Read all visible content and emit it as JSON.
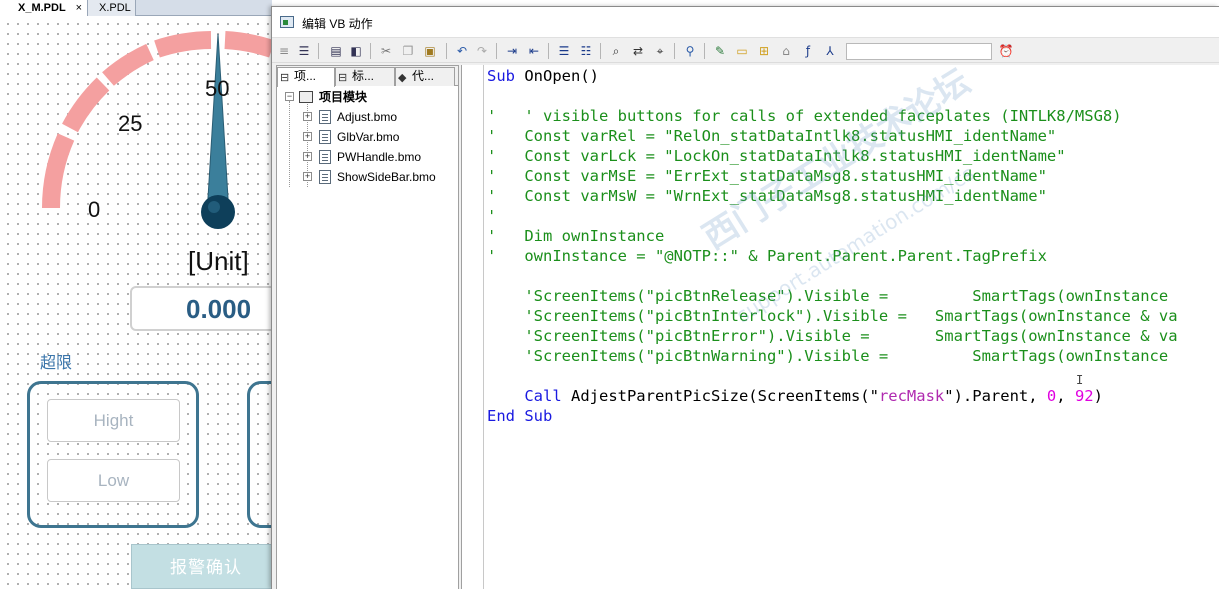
{
  "background_editor": {
    "tabs": [
      {
        "label": "X_M.PDL",
        "close": "×",
        "active": true
      },
      {
        "label": "X.PDL",
        "active": false
      }
    ],
    "gauge": {
      "ticks": [
        "0",
        "25",
        "50"
      ],
      "unit": "[Unit]",
      "value": "0.000"
    },
    "limit_group_label": "超限",
    "limit_buttons": [
      "Hight",
      "Low"
    ],
    "ack_button": "报警确认"
  },
  "dialog": {
    "title": "编辑 VB 动作",
    "left_panel_tabs": [
      "项...",
      "标...",
      "代..."
    ],
    "tree": {
      "root": "项目模块",
      "modules": [
        "Adjust.bmo",
        "GlbVar.bmo",
        "PWHandle.bmo",
        "ShowSideBar.bmo"
      ]
    },
    "code_lines": [
      "Sub OnOpen()",
      "",
      "'   ' visible buttons for calls of extended faceplates (INTLK8/MSG8)",
      "'   Const varRel = \"RelOn_statDataIntlk8.statusHMI_identName\"",
      "'   Const varLck = \"LockOn_statDataIntlk8.statusHMI_identName\"",
      "'   Const varMsE = \"ErrExt_statDataMsg8.statusHMI_identName\"",
      "'   Const varMsW = \"WrnExt_statDataMsg8.statusHMI_identName\"",
      "'",
      "'   Dim ownInstance",
      "'   ownInstance = \"@NOTP::\" & Parent.Parent.Parent.TagPrefix",
      "",
      "    'ScreenItems(\"picBtnRelease\").Visible =         SmartTags(ownInstance",
      "    'ScreenItems(\"picBtnInterlock\").Visible =   SmartTags(ownInstance & va",
      "    'ScreenItems(\"picBtnError\").Visible =       SmartTags(ownInstance & va",
      "    'ScreenItems(\"picBtnWarning\").Visible =         SmartTags(ownInstance",
      "",
      "    Call AdjestParentPicSize(ScreenItems(\"recMask\").Parent, 0, 92)",
      "End Sub"
    ],
    "watermark": "西门子工业技术论坛",
    "watermark_sub": "support.automation.com/cs"
  },
  "colors": {
    "gauge_arc": "#f4a0a0",
    "needle": "#3b7f9b",
    "value_text": "#2a5d84",
    "keyword": "#1a1ae0",
    "comment": "#1b8f1b",
    "string": "#b02ab0",
    "number": "#e000e0"
  },
  "icons": [
    "save-icon",
    "print-icon",
    "cut-icon",
    "copy-icon",
    "paste-icon",
    "undo-icon",
    "redo-icon",
    "indent-icon",
    "outdent-icon",
    "find-icon",
    "replace-icon",
    "bookmark-icon",
    "folder-icon",
    "clock-icon"
  ]
}
